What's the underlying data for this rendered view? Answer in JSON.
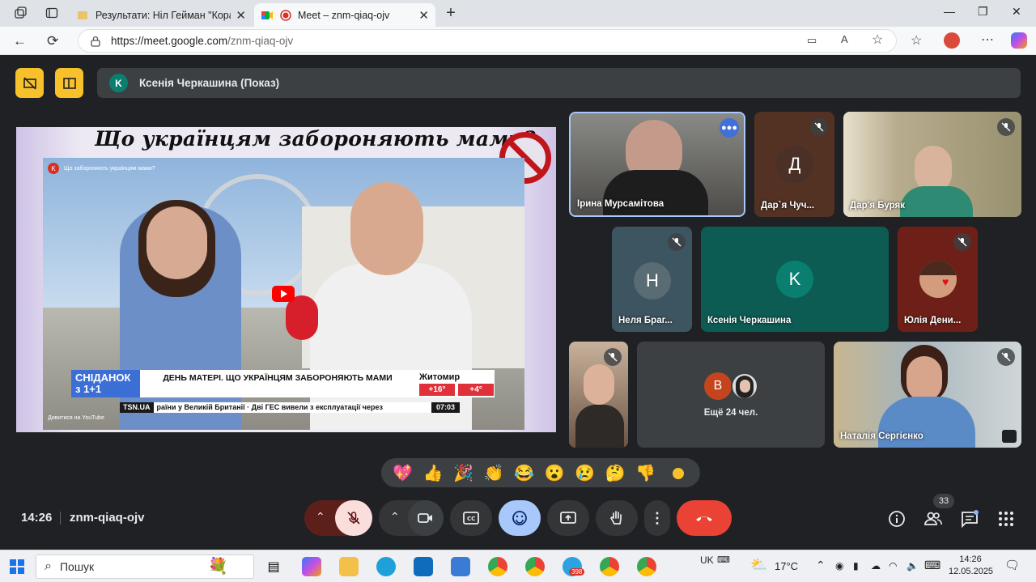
{
  "browser": {
    "tabs": [
      {
        "title": "Результати: Ніл Гейман \"Коралі",
        "active": false
      },
      {
        "title": "Meet – znm-qiaq-ojv",
        "active": true
      }
    ],
    "url_host": "https://meet.google.com",
    "url_path": "/znm-qiaq-ojv"
  },
  "meet": {
    "presenter_avatar": "K",
    "presenter_banner": "Ксенія Черкашина (Показ)",
    "presentation": {
      "headline": "Що українцям забороняють мами?",
      "video_header": "Що забороняють українцям мами?",
      "channel_letter": "K",
      "show_brand_line1": "СНІДАНОК",
      "show_brand_line2": "з 1+1",
      "lower_third": "ДЕНЬ МАТЕРІ. ЩО УКРАЇНЦЯМ ЗАБОРОНЯЮТЬ МАМИ",
      "city": "Житомир",
      "temp1": "+16°",
      "temp2": "+4°",
      "ticker_source": "TSN.UA",
      "ticker_text": "раїни у Великій Британії · Дві ГЕС вивели з експлуатації через",
      "ticker_time": "07:03",
      "watch_on": "Дивитися на  YouTube"
    },
    "participants": [
      {
        "name": "Ірина Мурсамітова",
        "muted": false,
        "speaking": true
      },
      {
        "name": "Дар`я Чуч...",
        "initial": "Д",
        "muted": true
      },
      {
        "name": "Дар'я Буряк",
        "muted": true
      },
      {
        "name": "Неля Браг...",
        "initial": "Н",
        "muted": true
      },
      {
        "name": "Ксенія Черкашина",
        "initial": "K",
        "muted": false
      },
      {
        "name": "Юлія Дени...",
        "muted": true
      },
      {
        "name": "",
        "muted": true
      },
      {
        "name": "Наталія Сергієнко",
        "muted": true
      }
    ],
    "others": {
      "initial": "В",
      "label": "Ещё 24 чел."
    },
    "reactions": [
      "💖",
      "👍",
      "🎉",
      "👏",
      "😂",
      "😮",
      "😢",
      "🤔",
      "👎"
    ],
    "time": "14:26",
    "meeting_code": "znm-qiaq-ojv",
    "participants_count": "33"
  },
  "taskbar": {
    "search_placeholder": "Пошук",
    "telegram_badge": "398",
    "lang": "UK",
    "weather": "17°C",
    "time": "14:26",
    "date": "12.05.2025"
  },
  "colors": {
    "meet_bg": "#202124",
    "accent_yellow": "#f6c12b",
    "hangup_red": "#ea4335",
    "reactions_active": "#a8c7fa",
    "mic_off_bg": "#f9dedc"
  }
}
